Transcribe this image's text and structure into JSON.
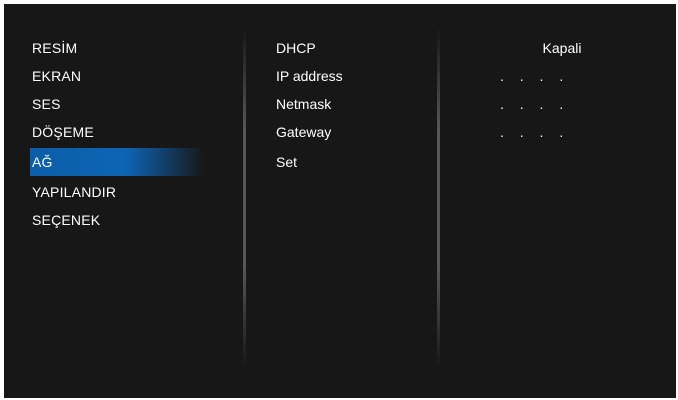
{
  "main_menu": {
    "items": [
      {
        "label": "RESİM"
      },
      {
        "label": "EKRAN"
      },
      {
        "label": "SES"
      },
      {
        "label": "DÖŞEME"
      },
      {
        "label": "AĞ",
        "selected": true
      },
      {
        "label": "YAPILANDIR"
      },
      {
        "label": "SEÇENEK"
      }
    ]
  },
  "network_menu": {
    "items": [
      {
        "label": "DHCP"
      },
      {
        "label": "IP address"
      },
      {
        "label": "Netmask"
      },
      {
        "label": "Gateway"
      },
      {
        "label": "Set"
      }
    ]
  },
  "values": {
    "dhcp": "Kapali",
    "ip_address": ". . . .",
    "netmask": ". . . .",
    "gateway": ". . . ."
  },
  "colors": {
    "background": "#171717",
    "selection": "#0d65b4",
    "text": "#ffffff"
  }
}
